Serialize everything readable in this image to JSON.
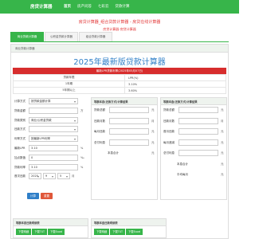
{
  "header": {
    "brand": "房贷计算器",
    "nav": [
      "首页",
      "房产问答",
      "七彩云",
      "贷款计算"
    ]
  },
  "headline": "房贷计算器_组合贷款计算器 - 房贷在线计算器",
  "sub_link": "房贷计算器-房贷计算器",
  "tabs": [
    "商业贷款计算器",
    "公积金贷款计算器",
    "组合贷款计算器"
  ],
  "panel_title": "商业贷款计算器",
  "big_title": "2025年最新版贷款计算器",
  "rate_bar": "最新LPR贷款利率(2025年05月07日)",
  "rate_table": [
    {
      "k": "贷款年限",
      "v": "LPR(%)"
    },
    {
      "k": "1年期",
      "v": "3.10%"
    },
    {
      "k": "5年期以上",
      "v": "3.60%"
    }
  ],
  "form": {
    "rows": [
      {
        "label": "计算方式",
        "value": "按贷款金额计算",
        "select": true,
        "unit": ""
      },
      {
        "label": "贷款金额",
        "value": "",
        "select": false,
        "unit": "万"
      },
      {
        "label": "贷款类别",
        "value": "商业/公积金贷款",
        "select": true,
        "unit": ""
      },
      {
        "label": "还款方式",
        "value": "",
        "select": false,
        "unit": ""
      },
      {
        "label": "利率方式",
        "value": "按最新LPR利率",
        "select": true,
        "unit": ""
      },
      {
        "label": "最新LPR",
        "value": "3.10",
        "select": false,
        "unit": "%"
      },
      {
        "label": "加点数值",
        "value": "0",
        "select": false,
        "unit": "‰"
      },
      {
        "label": "贷款利率",
        "value": "3.10",
        "select": false,
        "unit": "%"
      }
    ],
    "date": {
      "label": "首次还款",
      "year": "2025",
      "month": "9",
      "day": "5",
      "unit": "月"
    },
    "calc_label": "计算",
    "reset_label": "重置"
  },
  "results_left": {
    "title": "等额本息(还款方式)计算结果",
    "rows": [
      {
        "label": "贷款总额",
        "unit": "元"
      },
      {
        "label": "还款月数",
        "unit": "月"
      },
      {
        "label": "每月还款",
        "unit": "元"
      },
      {
        "label": "总付利息",
        "unit": "元"
      },
      {
        "label": "本息合计",
        "unit": "元"
      }
    ]
  },
  "results_right": {
    "title": "等额本金(还款方式)计算结果",
    "rows": [
      {
        "label": "贷款总额",
        "unit": "元"
      },
      {
        "label": "还款月数",
        "unit": "月"
      },
      {
        "label": "首月还款",
        "unit": "元"
      },
      {
        "label": "每月递减",
        "unit": "元"
      },
      {
        "label": "总付利息",
        "unit": "元"
      },
      {
        "label": "本息合计",
        "unit": "元"
      },
      {
        "label": "平均每月",
        "unit": "元"
      }
    ]
  },
  "detail_left": {
    "title": "等额本息还款明细表",
    "buttons": [
      "下载明细",
      "下载TXT",
      "下载Excel"
    ]
  },
  "detail_right": {
    "title": "等额本金还款明细表",
    "buttons": [
      "下载明细",
      "下载TXT",
      "下载Excel"
    ]
  },
  "colors": {
    "brand_green": "#37b54a",
    "title_blue": "#2f7fc8",
    "alert_red": "#d72d2d"
  }
}
